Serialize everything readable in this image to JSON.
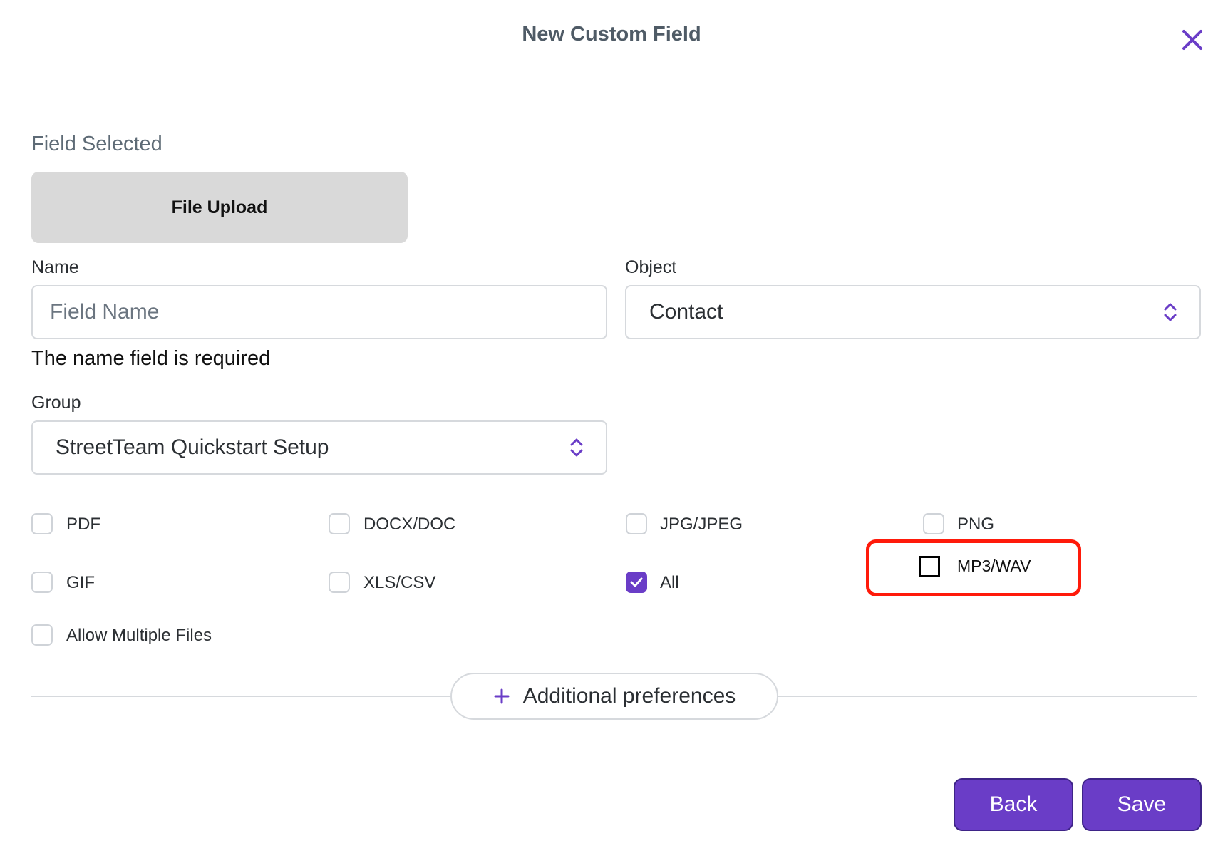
{
  "modal": {
    "title": "New Custom Field",
    "close_icon": "close-icon",
    "accent_color": "#6a3dc7"
  },
  "field_selected": {
    "label": "Field Selected",
    "value": "File Upload"
  },
  "name": {
    "label": "Name",
    "placeholder": "Field Name",
    "value": "",
    "error": "The name field is required"
  },
  "object": {
    "label": "Object",
    "value": "Contact"
  },
  "group": {
    "label": "Group",
    "value": "StreetTeam Quickstart Setup"
  },
  "file_types": {
    "pdf": {
      "label": "PDF",
      "checked": false
    },
    "docx": {
      "label": "DOCX/DOC",
      "checked": false
    },
    "jpg": {
      "label": "JPG/JPEG",
      "checked": false
    },
    "png": {
      "label": "PNG",
      "checked": false
    },
    "gif": {
      "label": "GIF",
      "checked": false
    },
    "xls": {
      "label": "XLS/CSV",
      "checked": false
    },
    "all": {
      "label": "All",
      "checked": true
    },
    "mp3": {
      "label": "MP3/WAV",
      "checked": false
    },
    "multiple": {
      "label": "Allow Multiple Files",
      "checked": false
    }
  },
  "additional_preferences": {
    "label": "Additional preferences",
    "icon": "plus-icon"
  },
  "footer": {
    "back_label": "Back",
    "save_label": "Save"
  }
}
